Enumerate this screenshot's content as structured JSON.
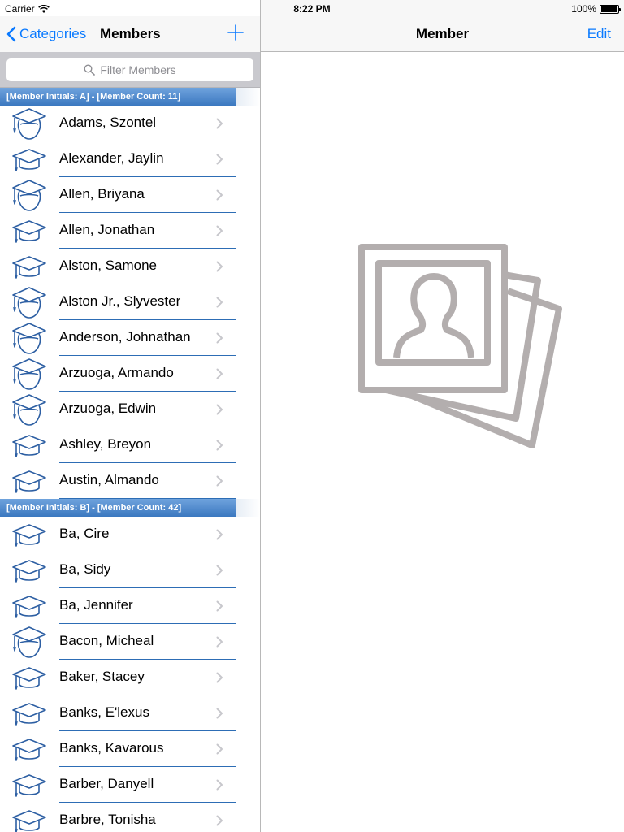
{
  "status": {
    "carrier": "Carrier",
    "time": "8:22 PM",
    "battery": "100%"
  },
  "master": {
    "back_label": "Categories",
    "title": "Members",
    "search_placeholder": "Filter Members",
    "sections": [
      {
        "header": "[Member Initials: A] - [Member Count: 11]",
        "rows": [
          {
            "name": "Adams, Szontel",
            "icon": "female-graduate-icon"
          },
          {
            "name": "Alexander, Jaylin",
            "icon": "graduation-cap-icon"
          },
          {
            "name": "Allen, Briyana",
            "icon": "female-graduate-icon"
          },
          {
            "name": "Allen, Jonathan",
            "icon": "graduation-cap-icon"
          },
          {
            "name": "Alston, Samone",
            "icon": "graduation-cap-icon"
          },
          {
            "name": "Alston Jr., Slyvester",
            "icon": "female-graduate-icon"
          },
          {
            "name": "Anderson, Johnathan",
            "icon": "female-graduate-icon"
          },
          {
            "name": "Arzuoga, Armando",
            "icon": "female-graduate-icon"
          },
          {
            "name": "Arzuoga, Edwin",
            "icon": "female-graduate-icon"
          },
          {
            "name": "Ashley, Breyon",
            "icon": "graduation-cap-icon"
          },
          {
            "name": "Austin, Almando",
            "icon": "graduation-cap-icon"
          }
        ]
      },
      {
        "header": "[Member Initials: B] - [Member Count: 42]",
        "rows": [
          {
            "name": "Ba, Cire",
            "icon": "graduation-cap-icon"
          },
          {
            "name": "Ba, Sidy",
            "icon": "graduation-cap-icon"
          },
          {
            "name": "Ba, Jennifer",
            "icon": "graduation-cap-icon"
          },
          {
            "name": "Bacon, Micheal",
            "icon": "female-graduate-icon"
          },
          {
            "name": "Baker, Stacey",
            "icon": "graduation-cap-icon"
          },
          {
            "name": "Banks, E'lexus",
            "icon": "graduation-cap-icon"
          },
          {
            "name": "Banks, Kavarous",
            "icon": "graduation-cap-icon"
          },
          {
            "name": "Barber, Danyell",
            "icon": "graduation-cap-icon"
          },
          {
            "name": "Barbre, Tonisha",
            "icon": "graduation-cap-icon"
          }
        ]
      }
    ]
  },
  "detail": {
    "title": "Member",
    "edit_label": "Edit",
    "placeholder_icon": "photo-stack-person-icon"
  },
  "colors": {
    "accent": "#0a7aff",
    "section_blue": "#3b78c0",
    "icon_blue": "#2d5fa3",
    "placeholder_gray": "#b3aeae"
  }
}
